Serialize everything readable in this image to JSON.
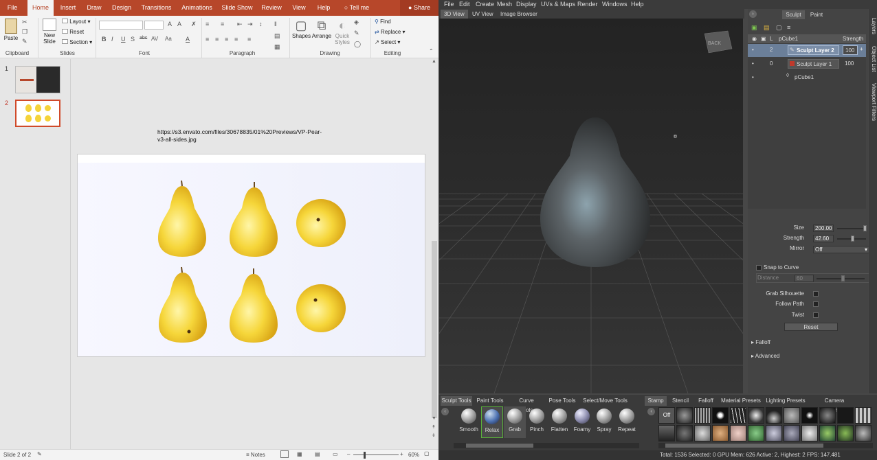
{
  "ppt": {
    "file_tab": "File",
    "tabs": [
      "Home",
      "Insert",
      "Draw",
      "Design",
      "Transitions",
      "Animations",
      "Slide Show",
      "Review",
      "View",
      "Help"
    ],
    "tell_me": "Tell me",
    "share": "Share",
    "clipboard": {
      "paste": "Paste",
      "label": "Clipboard"
    },
    "slides": {
      "new_slide_line1": "New",
      "new_slide_line2": "Slide",
      "layout": "Layout",
      "reset": "Reset",
      "section": "Section",
      "label": "Slides"
    },
    "font": {
      "label": "Font",
      "bold": "B",
      "italic": "I",
      "underline": "U",
      "strike": "S",
      "abc": "abc",
      "spacing": "AV",
      "case": "Aa",
      "color": "A"
    },
    "paragraph": {
      "label": "Paragraph"
    },
    "drawing": {
      "shapes": "Shapes",
      "arrange": "Arrange",
      "quick_styles_1": "Quick",
      "quick_styles_2": "Styles",
      "label": "Drawing"
    },
    "editing": {
      "find": "Find",
      "replace": "Replace",
      "select": "Select",
      "label": "Editing"
    },
    "slide_numbers": [
      "1",
      "2"
    ],
    "url_text": "https://s3.envato.com/files/30678835/01%20Previews/VP-Pear-v3-all-sides.jpg",
    "status": {
      "slide_of": "Slide 2 of 2",
      "notes": "Notes",
      "zoom": "60%",
      "minus": "–",
      "plus": "+"
    }
  },
  "mudbox": {
    "menu": [
      "File",
      "Edit",
      "Create",
      "Mesh",
      "Display",
      "UVs & Maps",
      "Render",
      "Windows",
      "Help"
    ],
    "view_tabs": [
      "3D View",
      "UV View",
      "Image Browser"
    ],
    "panel_tabs": [
      "Sculpt",
      "Paint"
    ],
    "layers": {
      "header_object": "pCube1",
      "header_strength": "Strength",
      "header_l": "L",
      "rows": [
        {
          "count": "2",
          "name": "Sculpt Layer 2",
          "strength": "100",
          "selected": true
        },
        {
          "count": "0",
          "name": "Sculpt Layer 1",
          "strength": "100",
          "selected": false
        },
        {
          "count": "",
          "name": "pCube1",
          "strength": "",
          "selected": false
        }
      ]
    },
    "props": {
      "size_label": "Size",
      "size": "200.00",
      "strength_label": "Strength",
      "strength": "42.60",
      "mirror_label": "Mirror",
      "mirror": "Off",
      "snap_label": "Snap to Curve",
      "distance_label": "Distance",
      "distance": "60",
      "grab_silhouette": "Grab Silhouette",
      "follow_path": "Follow Path",
      "twist": "Twist",
      "reset": "Reset",
      "falloff": "Falloff",
      "advanced": "Advanced"
    },
    "side_tabs": [
      "Layers",
      "Object List",
      "Viewport Filters"
    ],
    "cube_text": "BACK",
    "tray_tabs_left": [
      "Sculpt Tools",
      "Paint Tools",
      "Curve Tools",
      "Pose Tools",
      "Select/Move Tools"
    ],
    "tray_tabs_right": [
      "Stamp",
      "Stencil",
      "Falloff",
      "Material Presets",
      "Lighting Presets",
      "Camera Bookmarks"
    ],
    "tools": [
      "Smooth",
      "Relax",
      "Grab",
      "Pinch",
      "Flatten",
      "Foamy",
      "Spray",
      "Repeat"
    ],
    "stamp_off": "Off",
    "status": "Total: 1536  Selected: 0 GPU Mem: 626  Active: 2, Highest: 2  FPS: 147.481"
  }
}
